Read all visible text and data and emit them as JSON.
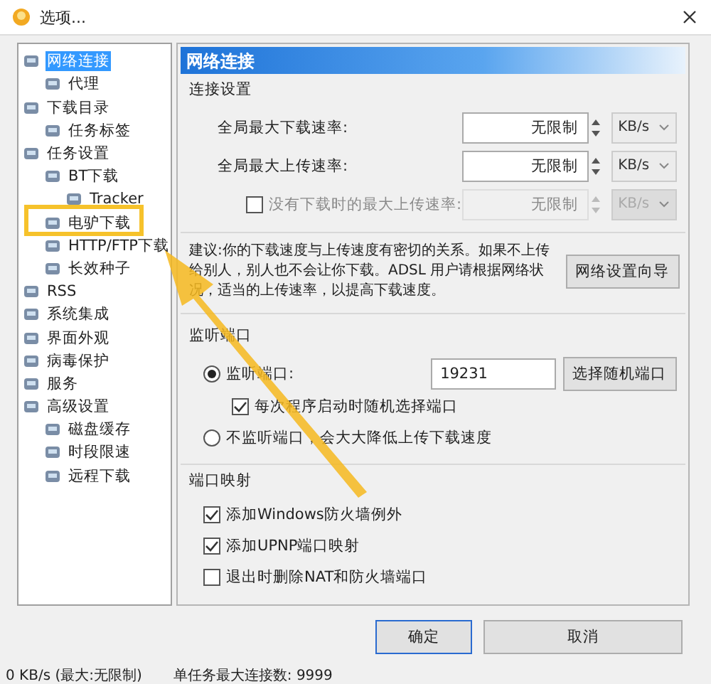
{
  "window": {
    "title": "选项..."
  },
  "tree": [
    {
      "label": "网络连接",
      "selected": true,
      "children": [
        {
          "label": "代理",
          "selected": false
        }
      ]
    },
    {
      "label": "下载目录",
      "selected": false,
      "children": [
        {
          "label": "任务标签",
          "selected": false
        }
      ]
    },
    {
      "label": "任务设置",
      "selected": false,
      "children": [
        {
          "label": "BT下载",
          "selected": false,
          "children": [
            {
              "label": "Tracker",
              "selected": false
            }
          ]
        },
        {
          "label": "电驴下载",
          "selected": false
        },
        {
          "label": "HTTP/FTP下载",
          "selected": false
        },
        {
          "label": "长效种子",
          "selected": false
        }
      ]
    },
    {
      "label": "RSS",
      "selected": false
    },
    {
      "label": "系统集成",
      "selected": false
    },
    {
      "label": "界面外观",
      "selected": false
    },
    {
      "label": "病毒保护",
      "selected": false
    },
    {
      "label": "服务",
      "selected": false
    },
    {
      "label": "高级设置",
      "selected": false,
      "children": [
        {
          "label": "磁盘缓存",
          "selected": false
        },
        {
          "label": "时段限速",
          "selected": false
        },
        {
          "label": "远程下载",
          "selected": false
        }
      ]
    }
  ],
  "panel": {
    "title": "网络连接",
    "connection": {
      "heading": "连接设置",
      "rows": [
        {
          "kind": "plain",
          "label": "全局最大下载速率:",
          "value": "无限制",
          "unit": "KB/s",
          "disabled": false
        },
        {
          "kind": "plain",
          "label": "全局最大上传速率:",
          "value": "无限制",
          "unit": "KB/s",
          "disabled": false
        },
        {
          "kind": "checkbox",
          "label": "没有下载时的最大上传速率:",
          "value": "无限制",
          "unit": "KB/s",
          "disabled": true,
          "checked": false
        }
      ]
    },
    "advice": {
      "text": "建议:你的下载速度与上传速度有密切的关系。如果不上传给别人，别人也不会让你下载。ADSL 用户请根据网络状况，适当的上传速率，以提高下载速度。",
      "button": "网络设置向导"
    },
    "listen": {
      "heading": "监听端口",
      "options": [
        {
          "label": "监听端口:",
          "selected": true
        },
        {
          "label": "不监听端口，会大大降低上传下载速度",
          "selected": false
        }
      ],
      "port": "19231",
      "random_button": "选择随机端口",
      "random_each_start": {
        "label": "每次程序启动时随机选择端口",
        "checked": true
      }
    },
    "mapping": {
      "heading": "端口映射",
      "options": [
        {
          "label": "添加Windows防火墙例外",
          "checked": true
        },
        {
          "label": "添加UPNP端口映射",
          "checked": true
        },
        {
          "label": "退出时删除NAT和防火墙端口",
          "checked": false
        }
      ]
    }
  },
  "buttons": [
    {
      "label": "确定",
      "default": true
    },
    {
      "label": "取消",
      "default": false
    }
  ],
  "status_bar": [
    "0 KB/s (最大:无限制)",
    "单任务最大连接数: 9999"
  ]
}
